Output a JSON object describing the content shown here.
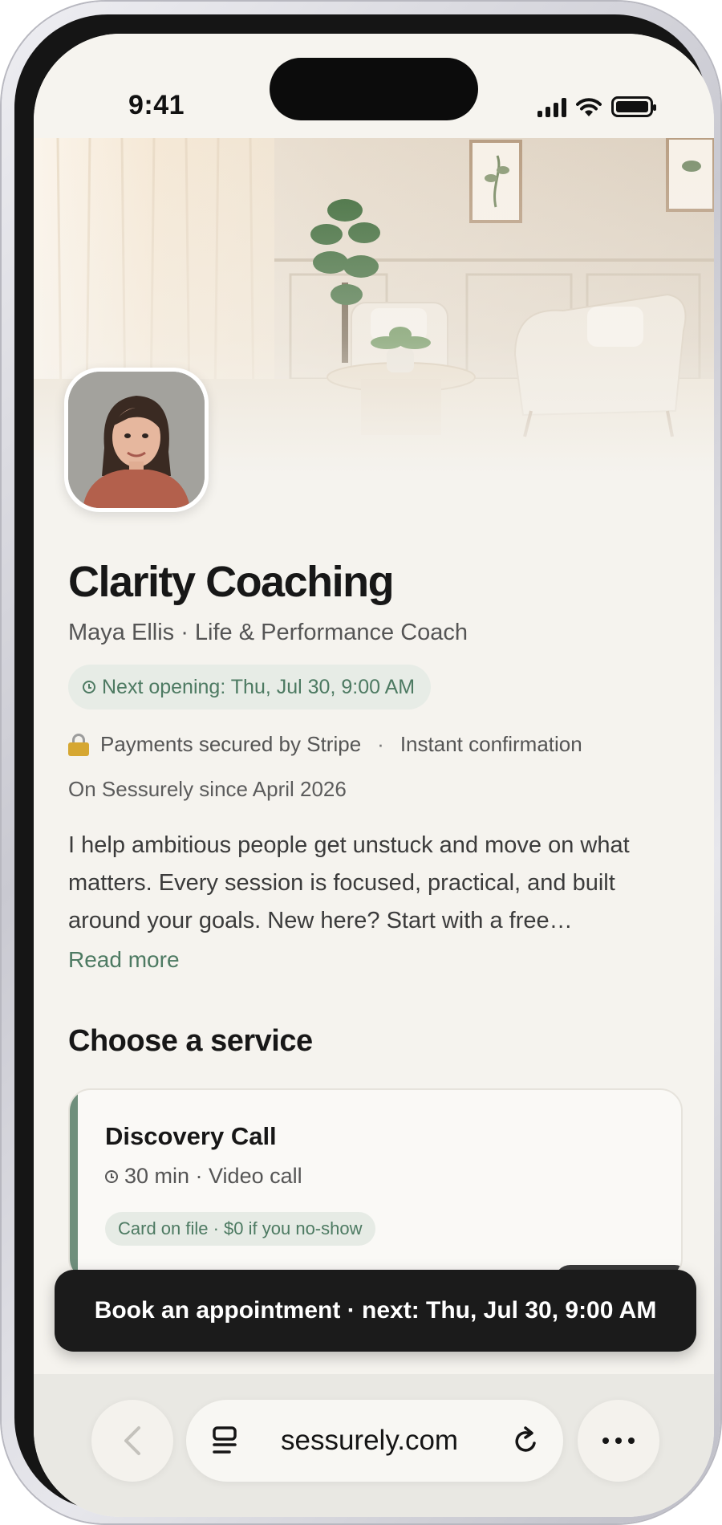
{
  "status_bar": {
    "time": "9:41"
  },
  "profile": {
    "business_name": "Clarity Coaching",
    "subtitle": "Maya Ellis · Life & Performance Coach",
    "next_opening": "Next opening: Thu, Jul 30, 9:00 AM",
    "payments_note": "Payments secured by Stripe",
    "separator": "·",
    "confirmation_note": "Instant confirmation",
    "member_since": "On Sessurely since April 2026",
    "bio": "I help ambitious people get unstuck and move on what matters. Every session is focused, practical, and built around your goals. New here? Start with a free…",
    "read_more": "Read more"
  },
  "services": {
    "heading": "Choose a service",
    "items": [
      {
        "title": "Discovery Call",
        "meta": "30 min · Video call",
        "badge": "Card on file · $0 if you no-show"
      }
    ]
  },
  "book_bar": {
    "label": "Book an appointment · next: Thu, Jul 30, 9:00 AM"
  },
  "browser": {
    "url": "sessurely.com"
  },
  "colors": {
    "accent_green": "#4d7a62",
    "pill_bg": "#e7ece6",
    "page_bg": "#f5f3ee",
    "book_bar_bg": "#1b1b1b"
  },
  "icons": {
    "lock": "lock-icon",
    "clock": "clock-icon",
    "back": "chevron-left-icon",
    "tabs": "tab-overview-icon",
    "reload": "reload-icon",
    "more": "more-dots-icon"
  }
}
